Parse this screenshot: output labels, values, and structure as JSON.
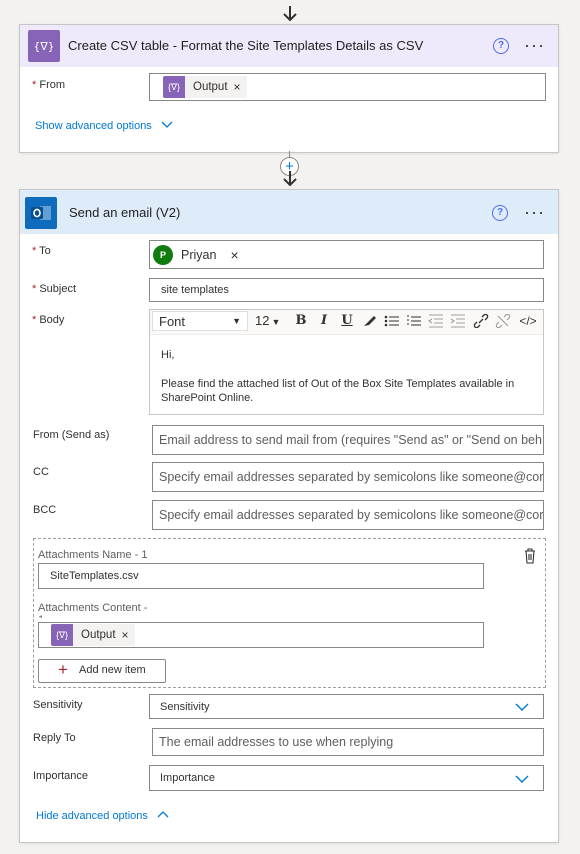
{
  "csv_card": {
    "title": "Create CSV table - Format the Site Templates Details as CSV",
    "help": "?",
    "more": "···",
    "from_label": "From",
    "from_token": "Output",
    "token_close": "×",
    "show_advanced": "Show advanced options"
  },
  "insert": {
    "plus": "+"
  },
  "email_card": {
    "title": "Send an email (V2)",
    "help": "?",
    "more": "···",
    "to_label": "To",
    "to_avatar": "P",
    "to_token": "Priyan",
    "to_close": "×",
    "subject_label": "Subject",
    "subject_value": "site templates",
    "body_label": "Body",
    "toolbar": {
      "font": "Font",
      "size": "12",
      "bold": "B",
      "italic": "I",
      "underline": "U",
      "code": "</>"
    },
    "body_lines": [
      "Hi,",
      "Please find the attached list of Out of the Box Site Templates available in",
      "SharePoint Online."
    ],
    "from_send_as_label": "From (Send as)",
    "from_send_as_placeholder": "Email address to send mail from (requires \"Send as\" or \"Send on beh",
    "cc_label": "CC",
    "cc_placeholder": "Specify email addresses separated by semicolons like someone@cor",
    "bcc_label": "BCC",
    "bcc_placeholder": "Specify email addresses separated by semicolons like someone@cor",
    "attachments": {
      "name_label": "Attachments Name - 1",
      "name_value": "SiteTemplates.csv",
      "content_label_line1": "Attachments Content -",
      "content_label_line2": "1",
      "content_token": "Output",
      "content_close": "×",
      "add_new_item": "Add new item"
    },
    "sensitivity_label": "Sensitivity",
    "sensitivity_value": "Sensitivity",
    "reply_to_label": "Reply To",
    "reply_to_placeholder": "The email addresses to use when replying",
    "importance_label": "Importance",
    "importance_value": "Importance",
    "hide_advanced": "Hide advanced options"
  },
  "colors": {
    "csv_header_bg": "#efeafb",
    "csv_icon": "#8764b8",
    "email_header_bg": "#deecf9",
    "outlook_blue": "#0f6cbd",
    "link": "#0078d4",
    "avatar": "#107c10"
  }
}
